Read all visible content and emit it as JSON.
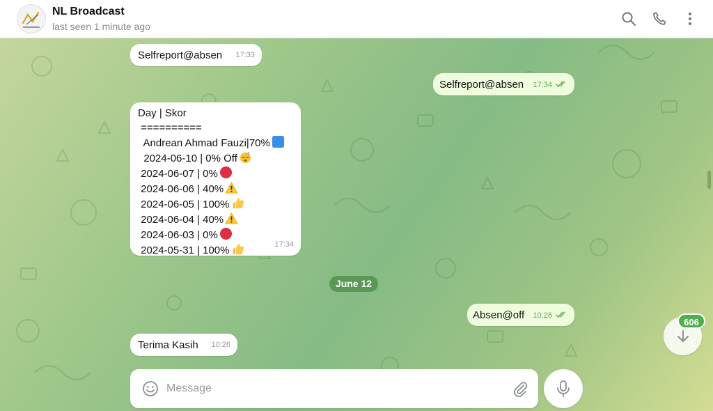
{
  "header": {
    "title": "NL Broadcast",
    "status": "last seen 1 minute ago",
    "icons": [
      "search-icon",
      "phone-icon",
      "more-vertical-icon"
    ]
  },
  "messages": [
    {
      "id": "m1",
      "direction": "incoming",
      "text": "Selfreport@absen",
      "time": "17:33"
    },
    {
      "id": "m2",
      "direction": "outgoing",
      "text": "Selfreport@absen",
      "time": "17:34",
      "read": true
    },
    {
      "id": "m3",
      "direction": "incoming",
      "time": "17:34",
      "lines": [
        "Day | Skor",
        " ==========",
        "  Andrean Ahmad Fauzi|70%",
        "  2024-06-10 | 0% Off",
        " 2024-06-07 | 0%",
        " 2024-06-06 | 40%",
        " 2024-06-05 | 100%",
        " 2024-06-04 | 40%",
        " 2024-06-03 | 0%",
        " 2024-05-31 | 100%"
      ],
      "line_emojis": [
        "",
        "",
        "blue-square",
        "sleeping-face",
        "red-circle",
        "warning",
        "thumbs-up",
        "warning",
        "red-circle",
        "thumbs-up"
      ]
    },
    {
      "id": "m4",
      "direction": "outgoing",
      "text": "Absen@off",
      "time": "10:26",
      "read": true
    },
    {
      "id": "m5",
      "direction": "incoming",
      "text": "Terima Kasih",
      "time": "10:26"
    }
  ],
  "date_separator": "June 12",
  "composer": {
    "placeholder": "Message"
  },
  "unread_count": "606",
  "colors": {
    "accent": "#4fae4e",
    "outgoing_bubble": "#effdde",
    "incoming_bubble": "#ffffff"
  }
}
